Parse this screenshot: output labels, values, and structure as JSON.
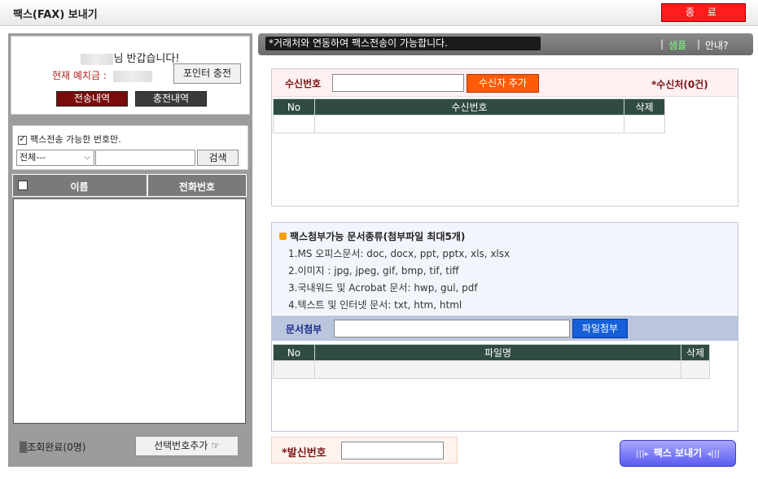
{
  "window": {
    "title": "팩스(FAX) 보내기",
    "close_label": "종 료"
  },
  "account": {
    "greeting_suffix": "님 반갑습니다!",
    "deposit_label": "현재 예치금 :",
    "charge_button": "포인터 충전",
    "send_history": "전송내역",
    "charge_history": "충전내역"
  },
  "search": {
    "fax_only_label": "팩스전송 가능한 번호만.",
    "fax_only_checked": true,
    "category_selected": "전체---",
    "search_button": "검색"
  },
  "contact_list": {
    "col_name": "이름",
    "col_phone": "전화번호",
    "status": "▒조회완료(0명)",
    "add_selected_button": "선택번호추가 ☞"
  },
  "notice": {
    "message": "*거래처와 연동하여  팩스전송이 가능합니다.",
    "sample_link": "샘플",
    "guide_link": "안내?",
    "separator": "|"
  },
  "recipient": {
    "label": "수신번호",
    "add_button": "수신자 추가",
    "count": "*수신처(0건)",
    "table_headers": [
      "No",
      "수신번호",
      "삭제"
    ]
  },
  "documents": {
    "heading": "팩스첨부가능 문서종류(첨부파일 최대5개)",
    "lines": [
      "1.MS 오피스문서: doc, docx, ppt, pptx, xls, xlsx",
      "2.이미지 : jpg, jpeg, gif, bmp, tif, tiff",
      "3.국내워드 및 Acrobat 문서: hwp, gul, pdf",
      "4.텍스트 및 인터넷 문서: txt, htm, html"
    ],
    "attach_label": "문서첨부",
    "attach_button": "파일첨부",
    "table_headers": [
      "No",
      "파일명",
      "삭제"
    ]
  },
  "sender": {
    "label": "*발신번호",
    "send_button": "팩스 보내기"
  },
  "colors": {
    "close_red": "#ff1c1c",
    "table_header": "#2f4b44",
    "add_orange": "#ff5a08",
    "attach_blue": "#1560d8",
    "send_purple": "#5a5af0"
  }
}
